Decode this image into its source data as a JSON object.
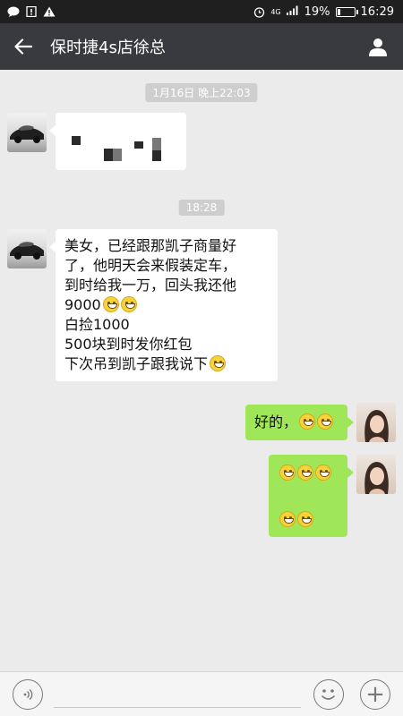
{
  "status_bar": {
    "left_icons": [
      "chat-icon",
      "notification-icon",
      "warning-icon"
    ],
    "alarm_icon": "alarm-icon",
    "network_label": "4G",
    "battery_percent": "19%",
    "battery_level": 0.19,
    "time": "16:29"
  },
  "header": {
    "back_icon": "arrow-left-icon",
    "title": "保时捷4s店徐总",
    "profile_icon": "person-icon"
  },
  "messages": [
    {
      "type": "timestamp",
      "text": "1月16日 晚上22:03"
    },
    {
      "type": "incoming",
      "avatar": "car-avatar",
      "content": "pixelated-image"
    },
    {
      "type": "timestamp",
      "text": "18:28"
    },
    {
      "type": "incoming",
      "avatar": "car-avatar",
      "lines": [
        "美女，已经跟那凯子商量好",
        "了，他明天会来假装定车，",
        "到时给我一万，回头我还他",
        "9000",
        "白捡1000",
        "500块到时发你红包",
        "下次吊到凯子跟我说下"
      ]
    },
    {
      "type": "outgoing",
      "avatar": "girl-avatar",
      "text": "好的，"
    },
    {
      "type": "outgoing",
      "avatar": "girl-avatar",
      "content": "emoji-only"
    }
  ],
  "input_bar": {
    "voice_icon": "voice-icon",
    "input_value": "",
    "emoji_icon": "smiley-icon",
    "plus_icon": "plus-icon",
    "plus_label": "+"
  },
  "colors": {
    "title_bar": "#393a3f",
    "chat_bg": "#ebebeb",
    "outgoing_bubble": "#9fe658",
    "incoming_bubble": "#ffffff"
  }
}
